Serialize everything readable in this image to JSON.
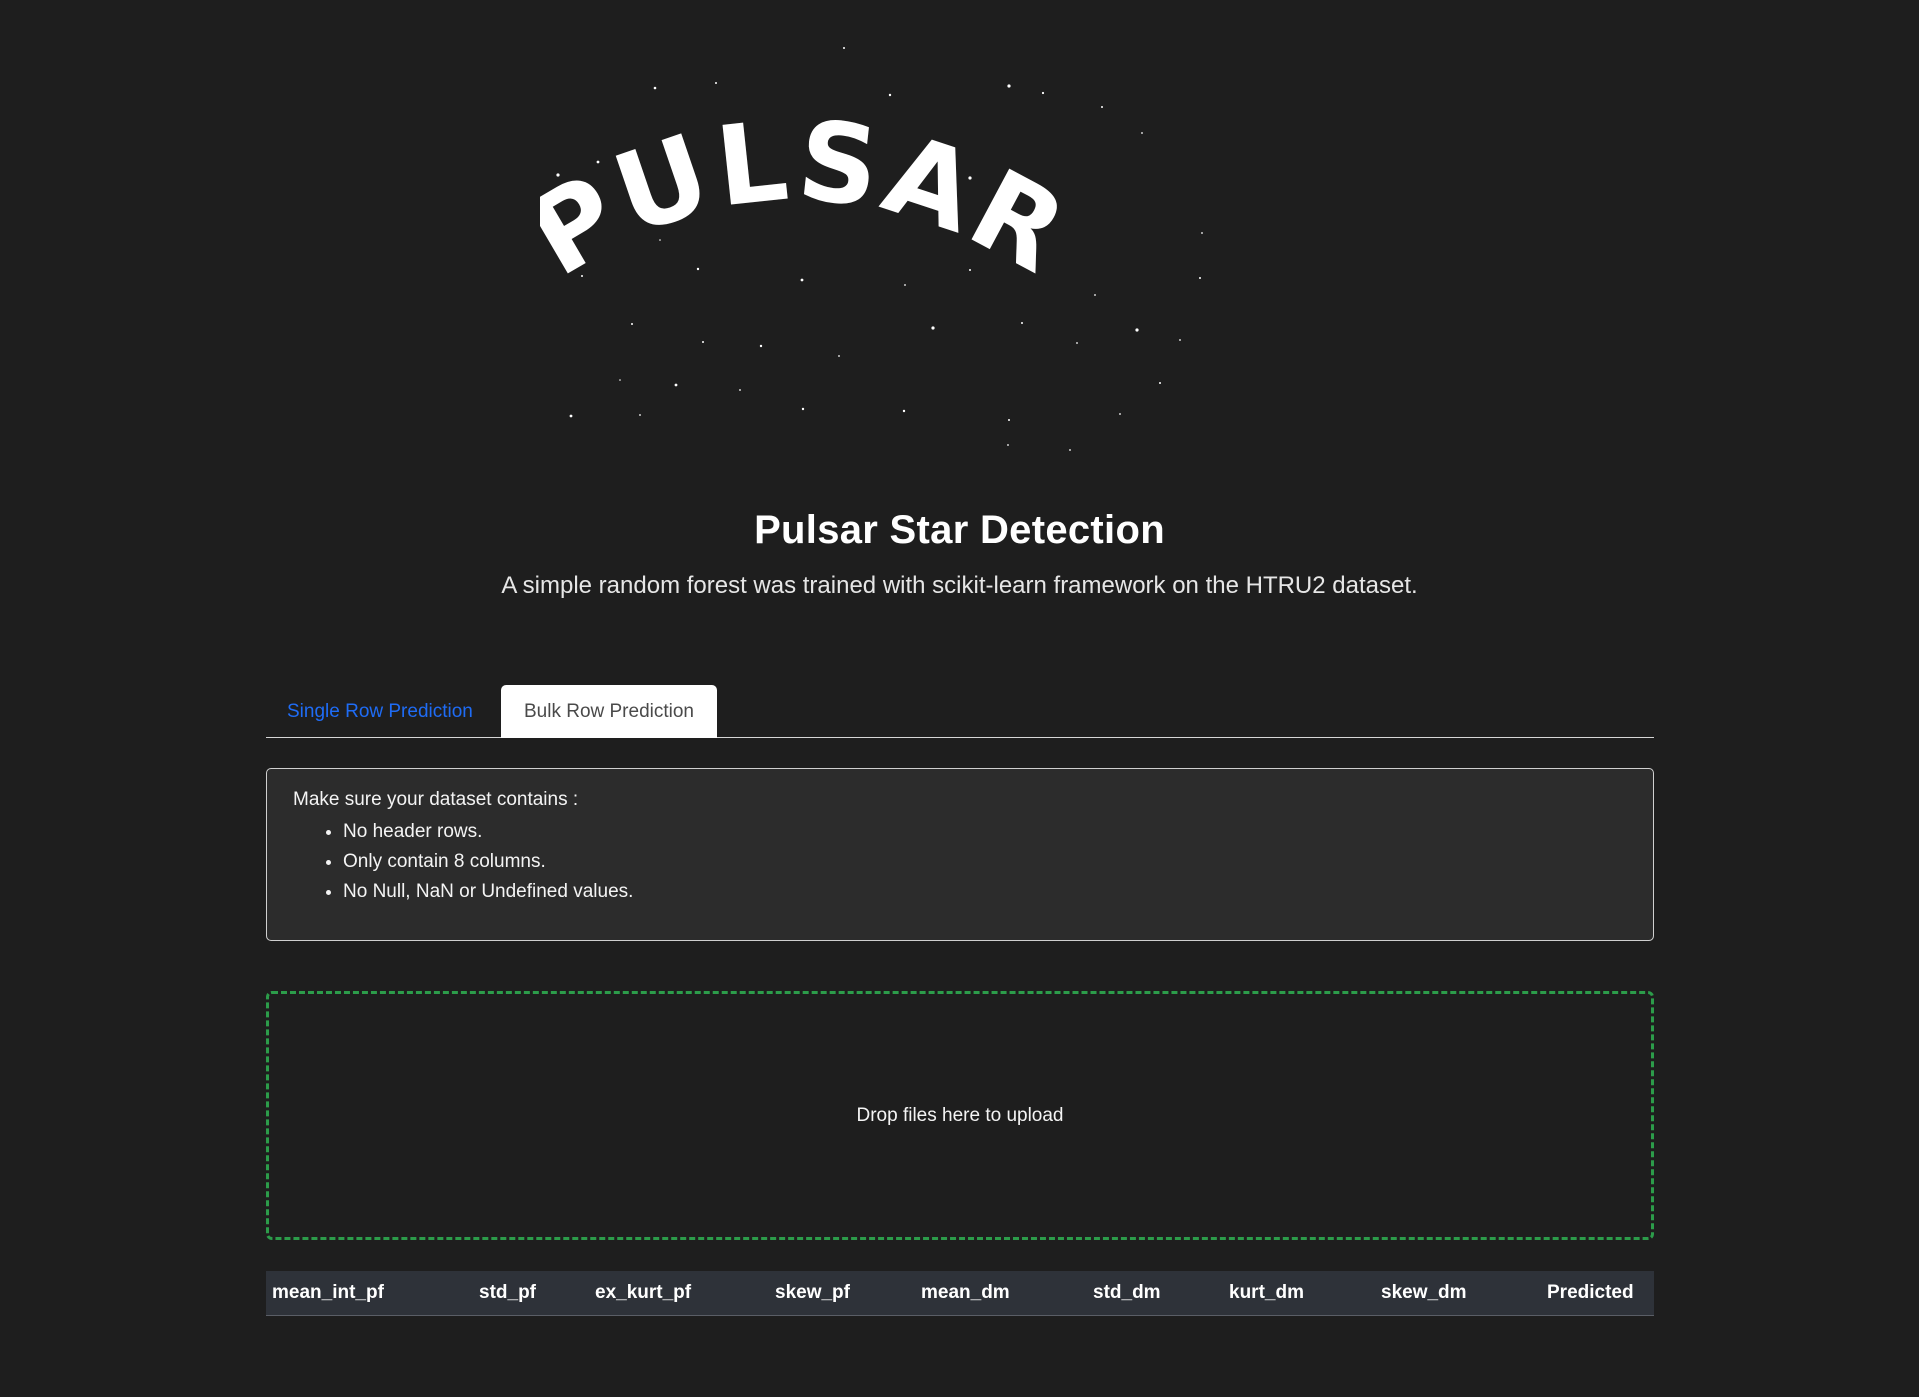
{
  "hero": {
    "logo_text": "PULSARS"
  },
  "header": {
    "title": "Pulsar Star Detection",
    "subtitle": "A simple random forest was trained with scikit-learn framework on the HTRU2 dataset."
  },
  "tabs": [
    {
      "label": "Single Row Prediction",
      "active": false
    },
    {
      "label": "Bulk Row Prediction",
      "active": true
    }
  ],
  "info": {
    "intro": "Make sure your dataset contains :",
    "items": [
      "No header rows.",
      "Only contain 8 columns.",
      "No Null, NaN or Undefined values."
    ]
  },
  "dropzone": {
    "label": "Drop files here to upload"
  },
  "table": {
    "columns": [
      "mean_int_pf",
      "std_pf",
      "ex_kurt_pf",
      "skew_pf",
      "mean_dm",
      "std_dm",
      "kurt_dm",
      "skew_dm",
      "Predicted"
    ]
  },
  "colors": {
    "background": "#1e1e1e",
    "tab_active_text": "#1f6cf5",
    "dropzone_border": "#2c9c4a",
    "table_header_bg": "#2e3239"
  }
}
